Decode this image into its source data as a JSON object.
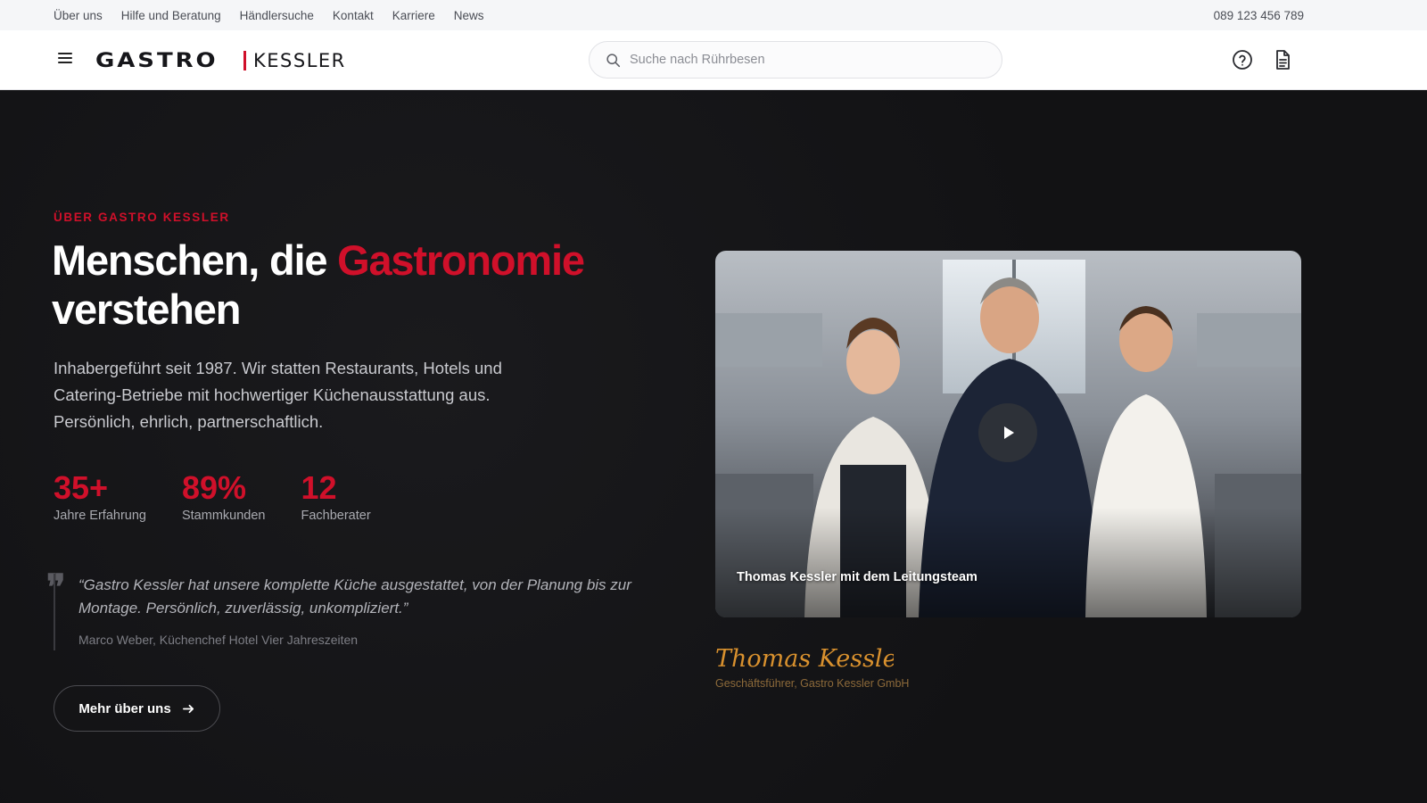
{
  "topbar": {
    "links": [
      "Über uns",
      "Hilfe und Beratung",
      "Händlersuche",
      "Kontakt",
      "Karriere",
      "News"
    ],
    "phone": "089 123 456 789"
  },
  "header": {
    "logo_part1": "GASTRO",
    "logo_part2": "KESSLER",
    "search_placeholder": "Suche nach Rührbesen",
    "icons": [
      "menu-icon",
      "search-icon",
      "help-icon",
      "document-icon"
    ]
  },
  "hero": {
    "eyebrow": "ÜBER GASTRO KESSLER",
    "headline_part1": "Menschen, die ",
    "headline_accent": "Gastronomie",
    "headline_part2": "verstehen",
    "lead": "Inhabergeführt seit 1987. Wir statten Restaurants, Hotels und Catering-Betriebe mit hochwertiger Küchenausstattung aus. Persönlich, ehrlich, partnerschaftlich.",
    "stats": [
      {
        "value": "35+",
        "label": "Jahre Erfahrung"
      },
      {
        "value": "89%",
        "label": "Stammkunden"
      },
      {
        "value": "12",
        "label": "Fachberater"
      }
    ],
    "quote_mark": "❞",
    "quote": "“Gastro Kessler hat unsere komplette Küche ausgestattet, von der Planung bis zur Montage. Persönlich, zuverlässig, unkompliziert.”",
    "quote_author": "Marco Weber, Küchenchef Hotel Vier Jahreszeiten",
    "cta_label": "Mehr über uns"
  },
  "video": {
    "caption": "Thomas Kessler mit dem Leitungsteam",
    "signature": "Thomas Kessler",
    "role": "Geschäftsführer, Gastro Kessler GmbH"
  },
  "colors": {
    "accent": "#d0102a",
    "background": "#121214",
    "signature": "#d9912e"
  }
}
